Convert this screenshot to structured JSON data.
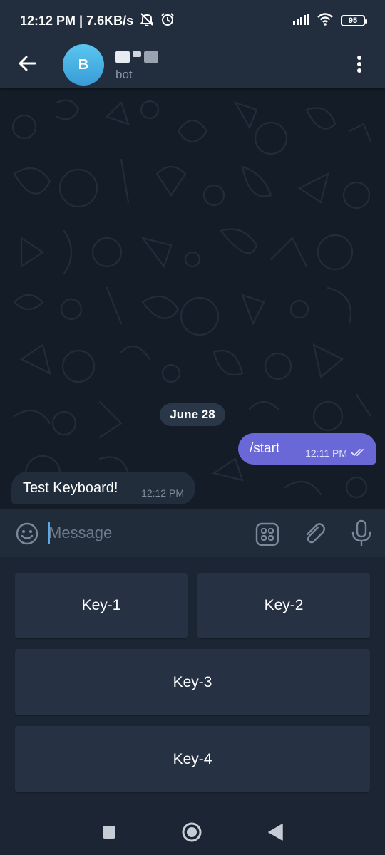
{
  "status_bar": {
    "time_speed": "12:12 PM | 7.6KB/s",
    "battery": "95",
    "icons": [
      "mute-alarm-icon",
      "alarm-icon",
      "signal-icon",
      "wifi-icon",
      "battery-icon"
    ]
  },
  "header": {
    "avatar_letter": "B",
    "status": "bot",
    "icons": [
      "back-arrow-icon",
      "more-vert-icon"
    ]
  },
  "chat": {
    "date": "June 28",
    "messages": [
      {
        "direction": "out",
        "text": "/start",
        "time": "12:11 PM",
        "read": true
      },
      {
        "direction": "in",
        "text": "Test Keyboard!",
        "time": "12:12 PM"
      }
    ]
  },
  "input": {
    "placeholder": "Message",
    "value": "",
    "icons": [
      "emoji-icon",
      "bot-keyboard-icon",
      "attach-icon",
      "mic-icon"
    ]
  },
  "keyboard": {
    "rows": [
      [
        "Key-1",
        "Key-2"
      ],
      [
        "Key-3"
      ],
      [
        "Key-4"
      ]
    ]
  },
  "nav": {
    "icons": [
      "recents-square-icon",
      "home-circle-icon",
      "back-triangle-icon"
    ]
  },
  "colors": {
    "header_bg": "#222e3d",
    "chat_bg": "#141c28",
    "outgoing_bubble": "#6a68d6",
    "incoming_bubble": "#212d3b",
    "key_bg": "#263244",
    "accent": "#5fa8e8"
  }
}
